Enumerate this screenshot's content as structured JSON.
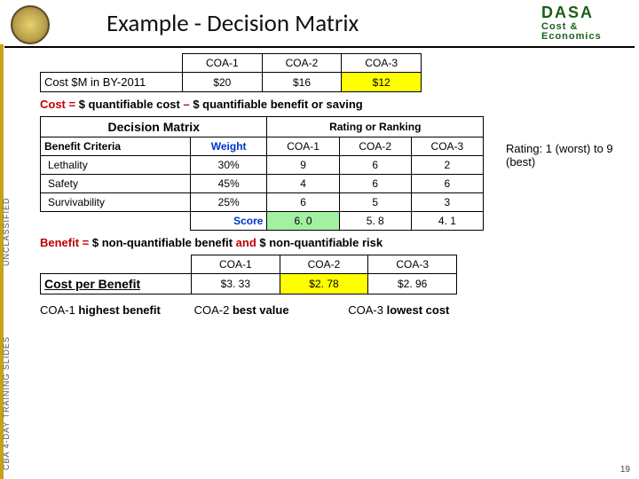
{
  "title": "Example - Decision Matrix",
  "dasa": {
    "line1": "DASA",
    "line2": "Cost & Economics"
  },
  "side": {
    "unclassified": "UNCLASSIFIED",
    "course": "CBA 4-DAY TRAINING SLIDES"
  },
  "costTable": {
    "rowLabel": "Cost $M in BY-2011",
    "cols": [
      "COA-1",
      "COA-2",
      "COA-3"
    ],
    "vals": [
      "$20",
      "$16",
      "$12"
    ]
  },
  "costFormula": {
    "lead": "Cost = ",
    "p1": "$ quantifiable cost ",
    "mid": "– ",
    "p2": "$ quantifiable benefit or saving"
  },
  "dm": {
    "title": "Decision Matrix",
    "ratingHdr": "Rating or Ranking",
    "benCrit": "Benefit Criteria",
    "weight": "Weight",
    "cols": [
      "COA-1",
      "COA-2",
      "COA-3"
    ],
    "rows": [
      {
        "label": "Lethality",
        "weight": "30%",
        "v": [
          "9",
          "6",
          "2"
        ]
      },
      {
        "label": "Safety",
        "weight": "45%",
        "v": [
          "4",
          "6",
          "6"
        ]
      },
      {
        "label": "Survivability",
        "weight": "25%",
        "v": [
          "6",
          "5",
          "3"
        ]
      }
    ],
    "scoreLabel": "Score",
    "score": [
      "6. 0",
      "5. 8",
      "4. 1"
    ]
  },
  "ratingNote": "Rating: 1 (worst) to 9 (best)",
  "benefitFormula": {
    "lead": "Benefit = ",
    "p1": "$ non-quantifiable benefit ",
    "mid": "and ",
    "p2": "$ non-quantifiable risk"
  },
  "cpb": {
    "label": "Cost per Benefit",
    "cols": [
      "COA-1",
      "COA-2",
      "COA-3"
    ],
    "vals": [
      "$3. 33",
      "$2. 78",
      "$2. 96"
    ]
  },
  "valueLine": {
    "a_pre": "COA-1 ",
    "a_em": "highest benefit",
    "b_pre": "COA-2 ",
    "b_em": "best value",
    "c_pre": "COA-3 ",
    "c_em": "lowest cost"
  },
  "pageNum": "19",
  "chart_data": {
    "type": "table",
    "tables": [
      {
        "name": "Cost $M in BY-2011",
        "cols": [
          "COA-1",
          "COA-2",
          "COA-3"
        ],
        "rows": [
          [
            20,
            16,
            12
          ]
        ]
      },
      {
        "name": "Decision Matrix (Rating)",
        "cols": [
          "Weight",
          "COA-1",
          "COA-2",
          "COA-3"
        ],
        "rows": [
          [
            "Lethality",
            "30%",
            9,
            6,
            2
          ],
          [
            "Safety",
            "45%",
            4,
            6,
            6
          ],
          [
            "Survivability",
            "25%",
            6,
            5,
            3
          ],
          [
            "Score",
            "",
            6.0,
            5.8,
            4.1
          ]
        ]
      },
      {
        "name": "Cost per Benefit",
        "cols": [
          "COA-1",
          "COA-2",
          "COA-3"
        ],
        "rows": [
          [
            3.33,
            2.78,
            2.96
          ]
        ]
      }
    ]
  }
}
